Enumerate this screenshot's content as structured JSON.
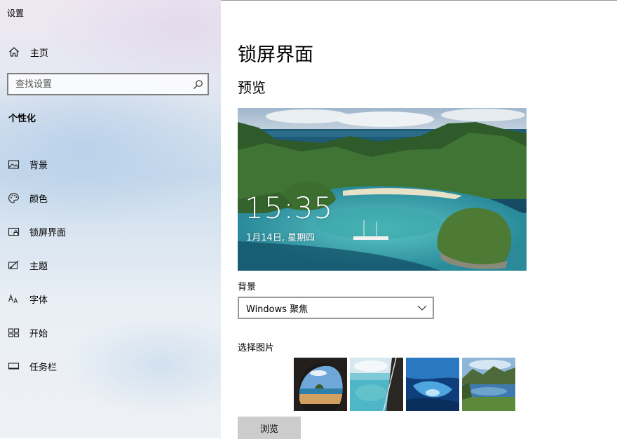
{
  "window": {
    "title": "设置"
  },
  "sidebar": {
    "home_label": "主页",
    "search_placeholder": "查找设置",
    "section_title": "个性化",
    "items": [
      {
        "label": "背景",
        "icon": "picture-icon"
      },
      {
        "label": "颜色",
        "icon": "palette-icon"
      },
      {
        "label": "锁屏界面",
        "icon": "lock-screen-icon"
      },
      {
        "label": "主题",
        "icon": "theme-icon"
      },
      {
        "label": "字体",
        "icon": "font-icon"
      },
      {
        "label": "开始",
        "icon": "start-icon"
      },
      {
        "label": "任务栏",
        "icon": "taskbar-icon"
      }
    ]
  },
  "main": {
    "page_title": "锁屏界面",
    "preview_title": "预览",
    "preview": {
      "time": "15:35",
      "date": "1月14日, 星期四"
    },
    "background_label": "背景",
    "background_select": "Windows 聚焦",
    "choose_picture_label": "选择图片",
    "browse_button": "浏览"
  }
}
